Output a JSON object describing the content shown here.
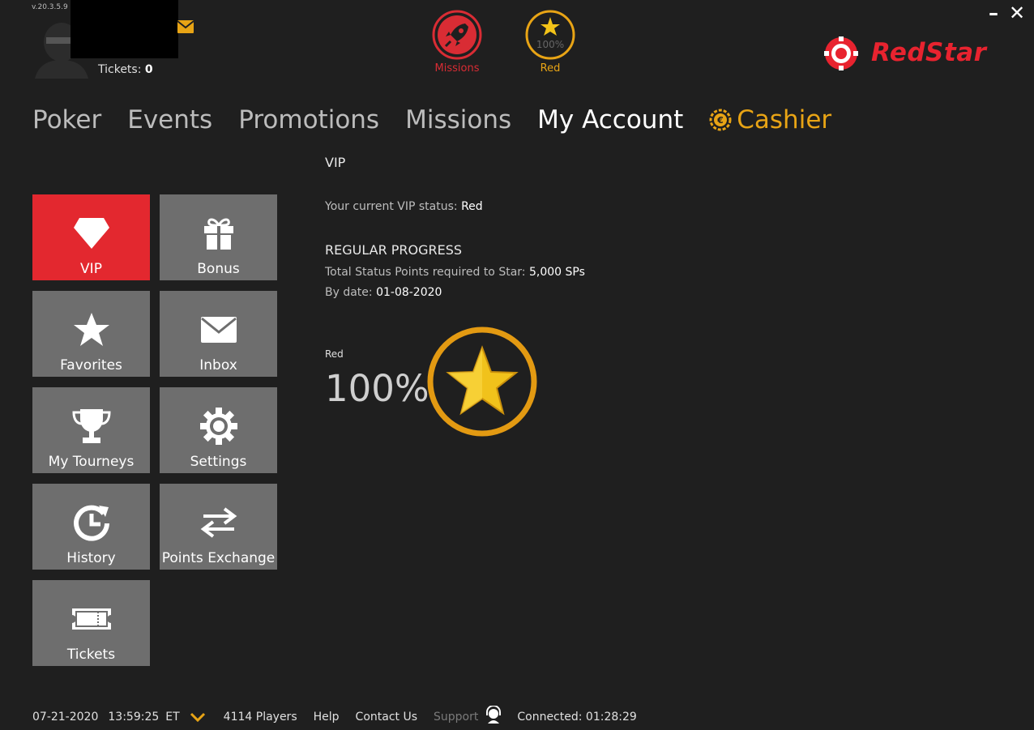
{
  "header": {
    "version": "v.20.3.5.9",
    "tickets_label": "Tickets:",
    "tickets_value": "0",
    "missions_label": "Missions",
    "vip_label": "Red",
    "vip_percent": "100%",
    "minimize": "–",
    "close": "✕",
    "brand": "RedStar"
  },
  "nav": {
    "items": [
      "Poker",
      "Events",
      "Promotions",
      "Missions",
      "My Account"
    ],
    "cashier": "Cashier",
    "active": "My Account"
  },
  "sidebar": {
    "tiles": [
      {
        "label": "VIP",
        "icon": "diamond-icon",
        "active": true
      },
      {
        "label": "Bonus",
        "icon": "gift-icon"
      },
      {
        "label": "Favorites",
        "icon": "star-icon"
      },
      {
        "label": "Inbox",
        "icon": "envelope-icon"
      },
      {
        "label": "My Tourneys",
        "icon": "trophy-icon"
      },
      {
        "label": "Settings",
        "icon": "gear-icon"
      },
      {
        "label": "History",
        "icon": "history-icon"
      },
      {
        "label": "Points Exchange",
        "icon": "exchange-icon"
      },
      {
        "label": "Tickets",
        "icon": "ticket-icon"
      }
    ]
  },
  "content": {
    "title": "VIP",
    "status_prefix": "Your current VIP status:",
    "status_value": "Red",
    "progress_heading": "REGULAR PROGRESS",
    "required_prefix": "Total Status Points required to Star:",
    "required_value": "5,000 SPs",
    "date_prefix": "By date:",
    "date_value": "01-08-2020",
    "level_name": "Red",
    "level_percent": "100%",
    "level_progress": 1.0
  },
  "footer": {
    "date": "07-21-2020",
    "time": "13:59:25",
    "tz": "ET",
    "players": "4114 Players",
    "help": "Help",
    "contact": "Contact Us",
    "support": "Support",
    "connected": "Connected: 01:28:29"
  },
  "colors": {
    "background": "#1f1f1f",
    "accent_red": "#e3282f",
    "accent_gold": "#e8a415",
    "tile_gray": "#6e6e6e"
  }
}
